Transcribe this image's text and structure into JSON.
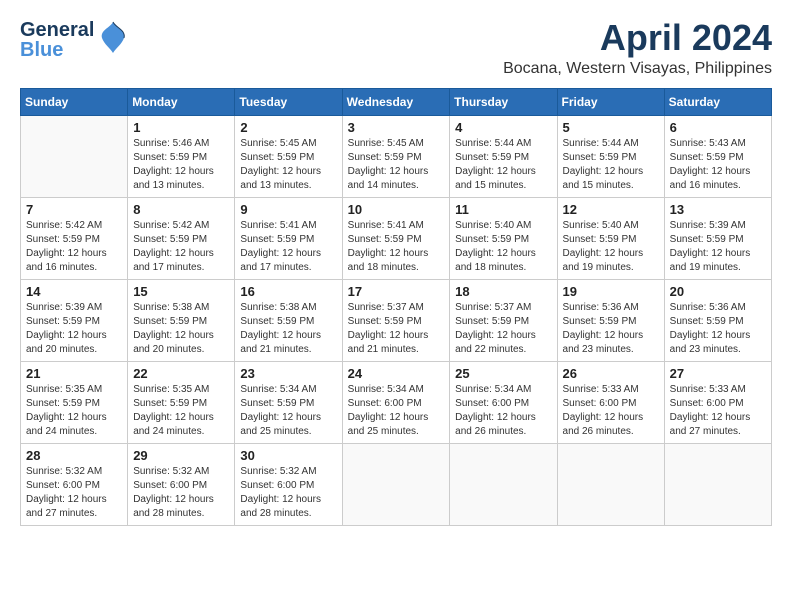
{
  "logo": {
    "general": "General",
    "blue": "Blue",
    "tagline": "GeneralBlue"
  },
  "title": "April 2024",
  "location": "Bocana, Western Visayas, Philippines",
  "days_of_week": [
    "Sunday",
    "Monday",
    "Tuesday",
    "Wednesday",
    "Thursday",
    "Friday",
    "Saturday"
  ],
  "weeks": [
    [
      {
        "day": "",
        "info": ""
      },
      {
        "day": "1",
        "info": "Sunrise: 5:46 AM\nSunset: 5:59 PM\nDaylight: 12 hours\nand 13 minutes."
      },
      {
        "day": "2",
        "info": "Sunrise: 5:45 AM\nSunset: 5:59 PM\nDaylight: 12 hours\nand 13 minutes."
      },
      {
        "day": "3",
        "info": "Sunrise: 5:45 AM\nSunset: 5:59 PM\nDaylight: 12 hours\nand 14 minutes."
      },
      {
        "day": "4",
        "info": "Sunrise: 5:44 AM\nSunset: 5:59 PM\nDaylight: 12 hours\nand 15 minutes."
      },
      {
        "day": "5",
        "info": "Sunrise: 5:44 AM\nSunset: 5:59 PM\nDaylight: 12 hours\nand 15 minutes."
      },
      {
        "day": "6",
        "info": "Sunrise: 5:43 AM\nSunset: 5:59 PM\nDaylight: 12 hours\nand 16 minutes."
      }
    ],
    [
      {
        "day": "7",
        "info": "Sunrise: 5:42 AM\nSunset: 5:59 PM\nDaylight: 12 hours\nand 16 minutes."
      },
      {
        "day": "8",
        "info": "Sunrise: 5:42 AM\nSunset: 5:59 PM\nDaylight: 12 hours\nand 17 minutes."
      },
      {
        "day": "9",
        "info": "Sunrise: 5:41 AM\nSunset: 5:59 PM\nDaylight: 12 hours\nand 17 minutes."
      },
      {
        "day": "10",
        "info": "Sunrise: 5:41 AM\nSunset: 5:59 PM\nDaylight: 12 hours\nand 18 minutes."
      },
      {
        "day": "11",
        "info": "Sunrise: 5:40 AM\nSunset: 5:59 PM\nDaylight: 12 hours\nand 18 minutes."
      },
      {
        "day": "12",
        "info": "Sunrise: 5:40 AM\nSunset: 5:59 PM\nDaylight: 12 hours\nand 19 minutes."
      },
      {
        "day": "13",
        "info": "Sunrise: 5:39 AM\nSunset: 5:59 PM\nDaylight: 12 hours\nand 19 minutes."
      }
    ],
    [
      {
        "day": "14",
        "info": "Sunrise: 5:39 AM\nSunset: 5:59 PM\nDaylight: 12 hours\nand 20 minutes."
      },
      {
        "day": "15",
        "info": "Sunrise: 5:38 AM\nSunset: 5:59 PM\nDaylight: 12 hours\nand 20 minutes."
      },
      {
        "day": "16",
        "info": "Sunrise: 5:38 AM\nSunset: 5:59 PM\nDaylight: 12 hours\nand 21 minutes."
      },
      {
        "day": "17",
        "info": "Sunrise: 5:37 AM\nSunset: 5:59 PM\nDaylight: 12 hours\nand 21 minutes."
      },
      {
        "day": "18",
        "info": "Sunrise: 5:37 AM\nSunset: 5:59 PM\nDaylight: 12 hours\nand 22 minutes."
      },
      {
        "day": "19",
        "info": "Sunrise: 5:36 AM\nSunset: 5:59 PM\nDaylight: 12 hours\nand 23 minutes."
      },
      {
        "day": "20",
        "info": "Sunrise: 5:36 AM\nSunset: 5:59 PM\nDaylight: 12 hours\nand 23 minutes."
      }
    ],
    [
      {
        "day": "21",
        "info": "Sunrise: 5:35 AM\nSunset: 5:59 PM\nDaylight: 12 hours\nand 24 minutes."
      },
      {
        "day": "22",
        "info": "Sunrise: 5:35 AM\nSunset: 5:59 PM\nDaylight: 12 hours\nand 24 minutes."
      },
      {
        "day": "23",
        "info": "Sunrise: 5:34 AM\nSunset: 5:59 PM\nDaylight: 12 hours\nand 25 minutes."
      },
      {
        "day": "24",
        "info": "Sunrise: 5:34 AM\nSunset: 6:00 PM\nDaylight: 12 hours\nand 25 minutes."
      },
      {
        "day": "25",
        "info": "Sunrise: 5:34 AM\nSunset: 6:00 PM\nDaylight: 12 hours\nand 26 minutes."
      },
      {
        "day": "26",
        "info": "Sunrise: 5:33 AM\nSunset: 6:00 PM\nDaylight: 12 hours\nand 26 minutes."
      },
      {
        "day": "27",
        "info": "Sunrise: 5:33 AM\nSunset: 6:00 PM\nDaylight: 12 hours\nand 27 minutes."
      }
    ],
    [
      {
        "day": "28",
        "info": "Sunrise: 5:32 AM\nSunset: 6:00 PM\nDaylight: 12 hours\nand 27 minutes."
      },
      {
        "day": "29",
        "info": "Sunrise: 5:32 AM\nSunset: 6:00 PM\nDaylight: 12 hours\nand 28 minutes."
      },
      {
        "day": "30",
        "info": "Sunrise: 5:32 AM\nSunset: 6:00 PM\nDaylight: 12 hours\nand 28 minutes."
      },
      {
        "day": "",
        "info": ""
      },
      {
        "day": "",
        "info": ""
      },
      {
        "day": "",
        "info": ""
      },
      {
        "day": "",
        "info": ""
      }
    ]
  ]
}
